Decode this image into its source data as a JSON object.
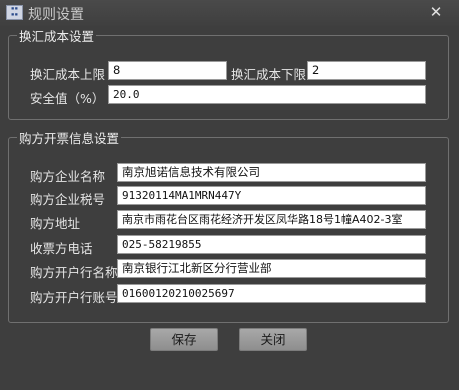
{
  "window": {
    "title": "规则设置",
    "close_glyph": "✕"
  },
  "cost_section": {
    "legend": "换汇成本设置",
    "upper_label": "换汇成本上限",
    "upper_value": "8",
    "lower_label": "换汇成本下限",
    "lower_value": "2",
    "safety_label": "安全值（%）",
    "safety_value": "20.0"
  },
  "buyer_section": {
    "legend": "购方开票信息设置",
    "fields": [
      {
        "label": "购方企业名称",
        "value": "南京旭诺信息技术有限公司"
      },
      {
        "label": "购方企业税号",
        "value": "91320114MA1MRN447Y"
      },
      {
        "label": "购方地址",
        "value": "南京市雨花台区雨花经济开发区凤华路18号1幢A402-3室"
      },
      {
        "label": "收票方电话",
        "value": "025-58219855"
      },
      {
        "label": "购方开户行名称",
        "value": "南京银行江北新区分行营业部"
      },
      {
        "label": "购方开户行账号",
        "value": "01600120210025697"
      }
    ]
  },
  "buttons": {
    "save": "保存",
    "close": "关闭"
  }
}
